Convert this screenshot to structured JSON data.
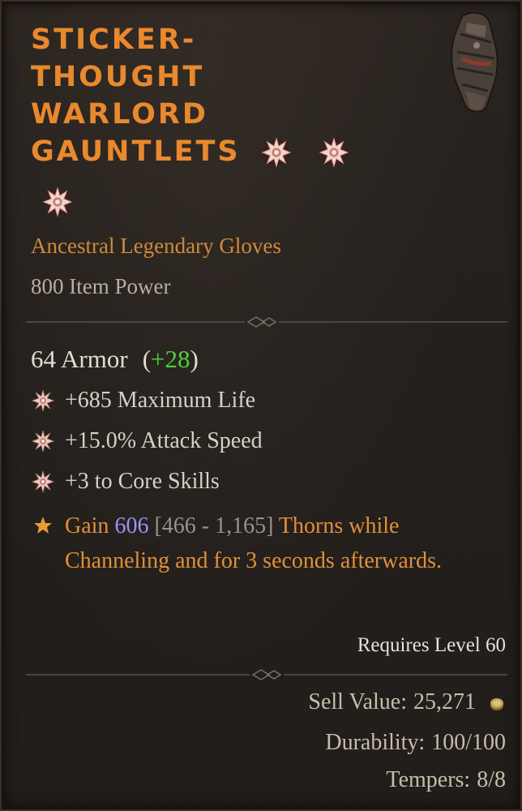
{
  "item": {
    "name_lines": [
      "STICKER-",
      "THOUGHT",
      "WARLORD",
      "GAUNTLETS"
    ],
    "subtype": "Ancestral Legendary Gloves",
    "item_power": "800 Item Power",
    "armor_text": "64 Armor",
    "armor_bonus_open": "(",
    "armor_bonus": "+28",
    "armor_bonus_close": ")",
    "sockets_icon": "greater-affix-star-icon",
    "item_image_icon": "gauntlet-icon"
  },
  "affixes": [
    {
      "text": "+685 Maximum Life",
      "icon": "greater-affix-icon"
    },
    {
      "text": "+15.0% Attack Speed",
      "icon": "greater-affix-icon"
    },
    {
      "text": "+3 to Core Skills",
      "icon": "greater-affix-icon"
    }
  ],
  "aspect": {
    "icon": "legendary-star-icon",
    "prefix": "Gain",
    "value": "606",
    "range": "[466 - 1,165]",
    "suffix": "Thorns while Channeling and for 3 seconds afterwards."
  },
  "requirements": {
    "level_text": "Requires Level 60"
  },
  "footer": {
    "sell_label": "Sell Value:",
    "sell_value": "25,271",
    "durability_label": "Durability:",
    "durability_value": "100/100",
    "tempers_label": "Tempers:",
    "tempers_value": "8/8"
  },
  "colors": {
    "title": "#e8892e",
    "legendary": "#cf8a3a",
    "bonus_green": "#4cd23a",
    "aspect_value": "#9a95f2"
  }
}
